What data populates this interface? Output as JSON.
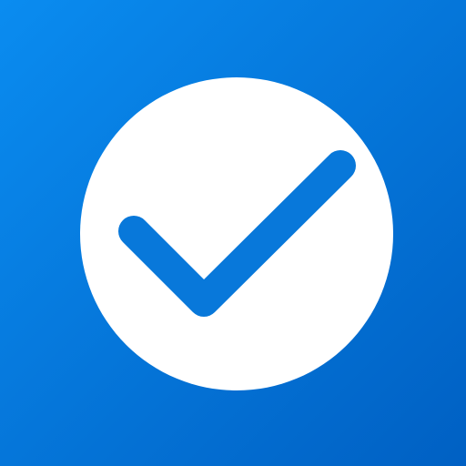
{
  "icon": {
    "name": "check-circle-icon",
    "colors": {
      "background_start": "#0A8CF0",
      "background_end": "#0060C3",
      "circle": "#FFFFFF",
      "checkmark": "#0878DA"
    }
  }
}
